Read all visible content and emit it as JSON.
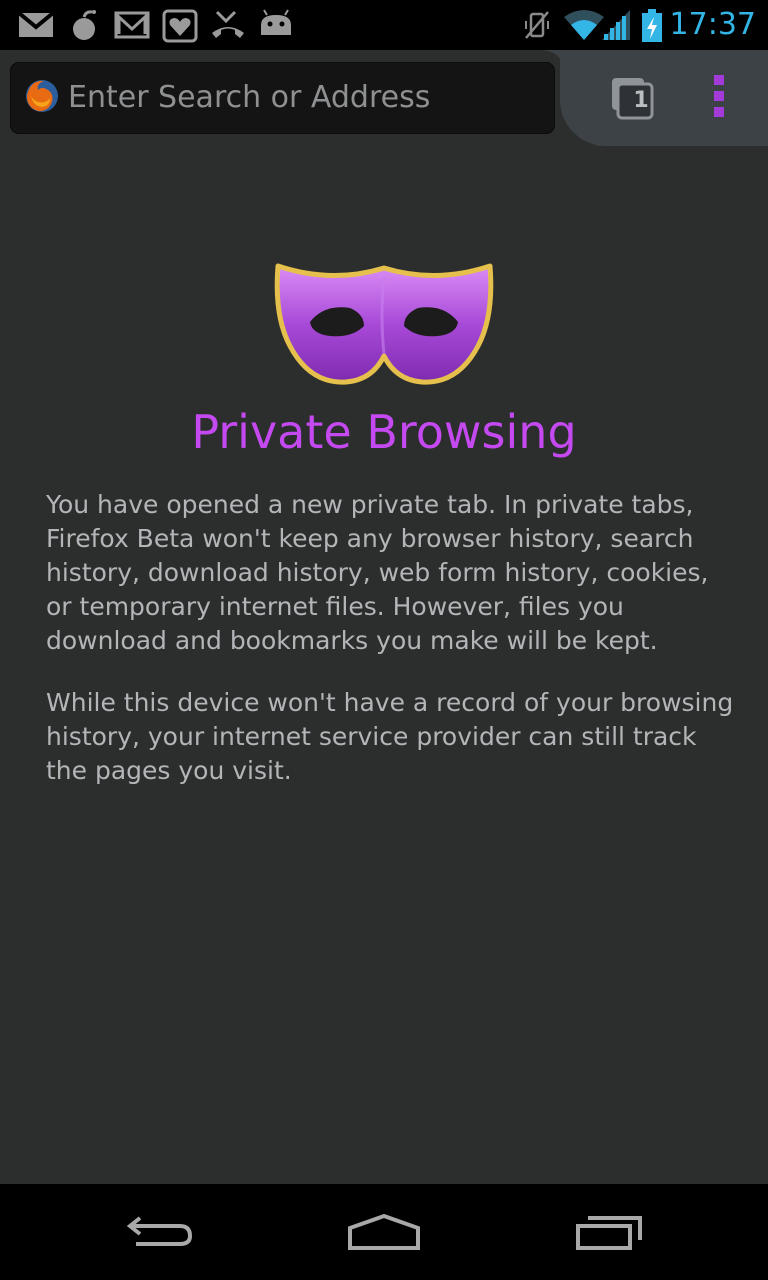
{
  "status_bar": {
    "time": "17:37",
    "left_icons": [
      "gmail-icon",
      "bomb-icon",
      "email-icon",
      "heart-app-icon",
      "missed-call-icon",
      "android-icon"
    ],
    "right_icons": [
      "vibrate-off-icon",
      "wifi-icon",
      "signal-icon",
      "battery-charging-icon"
    ],
    "accent_color": "#33b5e5"
  },
  "toolbar": {
    "url_placeholder": "Enter Search or Address",
    "tab_count": "1"
  },
  "content": {
    "title": "Private Browsing",
    "paragraph1": "You have opened a new private tab. In private tabs, Firefox Beta won't keep any browser history, search history, download history, web form history, cookies, or temporary internet files. However, files you download and bookmarks you make will be kept.",
    "paragraph2": "While this device won't have a record of your browsing history, your internet service provider can still track the pages you visit.",
    "title_color": "#c449f0"
  },
  "nav_bar": {
    "buttons": [
      "back-icon",
      "home-icon",
      "recent-apps-icon"
    ]
  }
}
